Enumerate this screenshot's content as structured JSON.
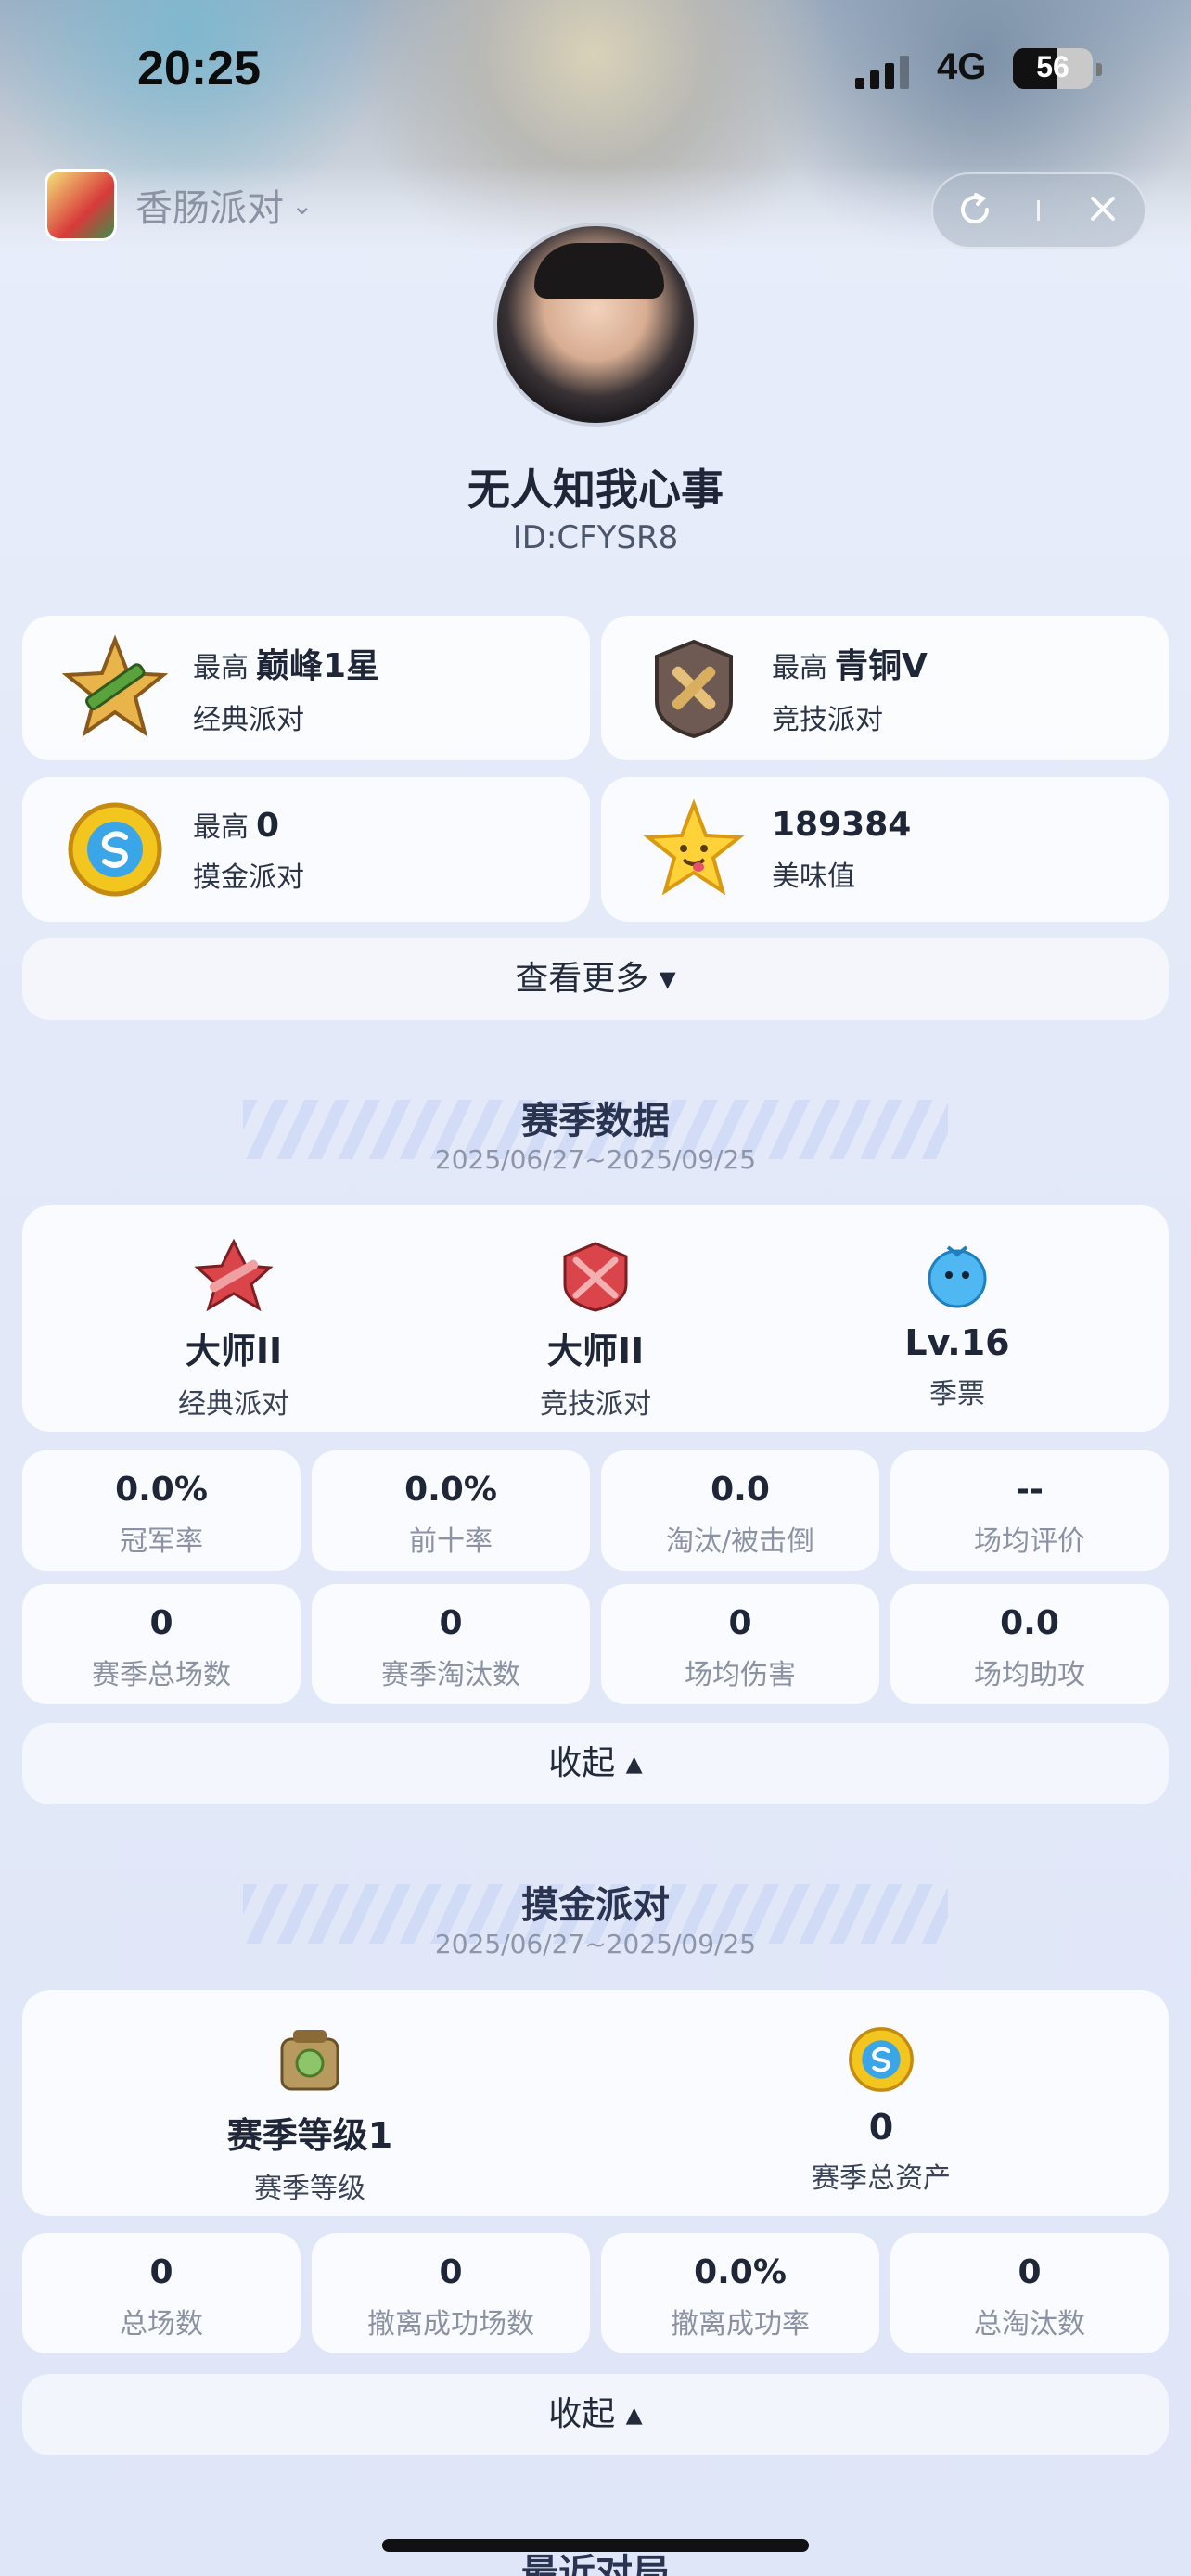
{
  "status_bar": {
    "time": "20:25",
    "network": "4G",
    "battery": "56",
    "battery_fraction": 0.56
  },
  "app_bar": {
    "app_name": "香肠派对",
    "dropdown_icon": "chevron-down-icon",
    "refresh_icon": "refresh-icon",
    "close_icon": "close-icon"
  },
  "profile": {
    "nickname": "无人知我心事",
    "user_id": "ID:CFYSR8"
  },
  "rank_cards": [
    {
      "prefix": "最高",
      "value": "巅峰1星",
      "mode": "经典派对",
      "icon": "classic-rank-icon"
    },
    {
      "prefix": "最高",
      "value": "青铜V",
      "mode": "竞技派对",
      "icon": "bronze-rank-icon"
    },
    {
      "prefix": "最高",
      "value": "0",
      "mode": "摸金派对",
      "icon": "gold-coin-icon"
    },
    {
      "prefix": "",
      "value": "189384",
      "mode": "美味值",
      "icon": "tasty-star-icon"
    }
  ],
  "more_button": {
    "label": "查看更多 ▾"
  },
  "season": {
    "title": "赛季数据",
    "date_range": "2025/06/27~2025/09/25",
    "tiers": [
      {
        "value": "大师II",
        "label": "经典派对",
        "icon": "master-classic-icon"
      },
      {
        "value": "大师II",
        "label": "竞技派对",
        "icon": "master-competitive-icon"
      },
      {
        "value": "Lv.16",
        "label": "季票",
        "icon": "season-pass-icon"
      }
    ],
    "stats": [
      {
        "value": "0.0%",
        "label": "冠军率"
      },
      {
        "value": "0.0%",
        "label": "前十率"
      },
      {
        "value": "0.0",
        "label": "淘汰/被击倒"
      },
      {
        "value": "--",
        "label": "场均评价"
      },
      {
        "value": "0",
        "label": "赛季总场数"
      },
      {
        "value": "0",
        "label": "赛季淘汰数"
      },
      {
        "value": "0",
        "label": "场均伤害"
      },
      {
        "value": "0.0",
        "label": "场均助攻"
      }
    ],
    "collapse_label": "收起 ▴"
  },
  "gold_party": {
    "title": "摸金派对",
    "date_range": "2025/06/27~2025/09/25",
    "tiers": [
      {
        "value": "赛季等级1",
        "label": "赛季等级",
        "icon": "season-level-icon"
      },
      {
        "value": "0",
        "label": "赛季总资产",
        "icon": "gold-coin-icon"
      }
    ],
    "stats": [
      {
        "value": "0",
        "label": "总场数"
      },
      {
        "value": "0",
        "label": "撤离成功场数"
      },
      {
        "value": "0.0%",
        "label": "撤离成功率"
      },
      {
        "value": "0",
        "label": "总淘汰数"
      }
    ],
    "collapse_label": "收起 ▴"
  },
  "recent": {
    "title": "最近对局"
  },
  "colors": {
    "background": "#e6ecfa",
    "card": "#ffffff",
    "primary_text": "#1f2638",
    "muted_text": "#8a92a3"
  }
}
